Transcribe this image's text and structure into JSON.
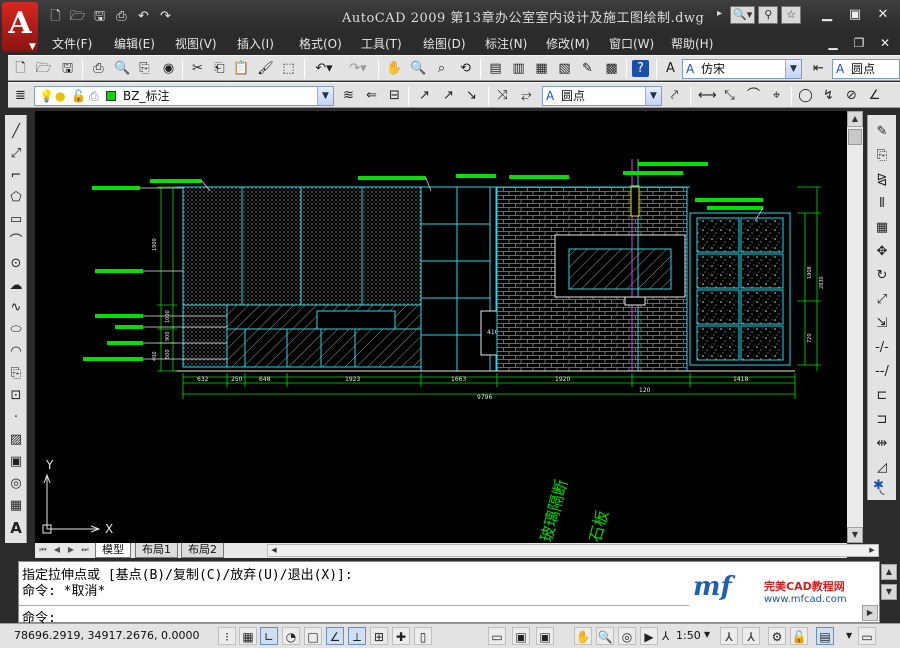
{
  "titlebar": {
    "logo_letter": "A",
    "title": "AutoCAD 2009  第13章办公室室内设计及施工图绘制.dwg",
    "nav_arrow": "▸",
    "qa_icons": [
      "new-icon",
      "open-icon",
      "save-icon",
      "print-icon",
      "undo-icon",
      "redo-icon"
    ],
    "tools": [
      "search-icon",
      "network-icon",
      "favorites-icon"
    ]
  },
  "menu": {
    "items": [
      "文件(F)",
      "编辑(E)",
      "视图(V)",
      "插入(I)",
      "格式(O)",
      "工具(T)",
      "绘图(D)",
      "标注(N)",
      "修改(M)",
      "窗口(W)",
      "帮助(H)"
    ]
  },
  "toolbar1": {
    "text_style": "仿宋",
    "dim_style": "圆点"
  },
  "toolbar2": {
    "layer": "BZ_标注",
    "mleader_style": "圆点"
  },
  "drawing": {
    "ucs_x": "X",
    "ucs_y": "Y",
    "partial_text_1": "玻璃隔断",
    "partial_text_2": "石板",
    "dimensions_bottom": [
      "632",
      "250",
      "648",
      "1923",
      "1663",
      "1920",
      "120",
      "1418"
    ],
    "dimension_total": "9796",
    "dimension_mid": "410",
    "dimensions_left": [
      "1900",
      "1000",
      "900",
      "500",
      "400"
    ],
    "dimensions_right": [
      "1908",
      "2830",
      "720"
    ],
    "colors": {
      "cyan": "#22d8e8",
      "green": "#00e000",
      "yellow": "#e8e800",
      "magenta": "#e040e0",
      "white": "#e8e8e8"
    }
  },
  "tabs": [
    "模型",
    "布局1",
    "布局2"
  ],
  "command": {
    "line1": "指定拉伸点或 [基点(B)/复制(C)/放弃(U)/退出(X)]:",
    "line2": "命令: *取消*",
    "prompt": "命令:"
  },
  "watermark": {
    "logo": "mf",
    "name": "完美CAD教程网",
    "url": "www.mfcad.com"
  },
  "status": {
    "coords": "78696.2919, 34917.2676, 0.0000",
    "scale": "1:50"
  }
}
